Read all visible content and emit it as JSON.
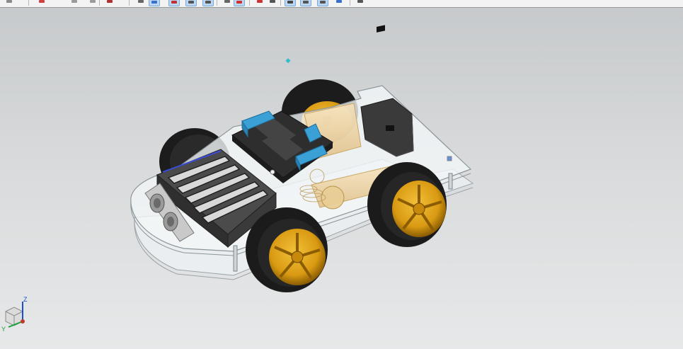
{
  "toolbar": {
    "buttons": [
      {
        "icon": "undo-icon"
      },
      {
        "icon": "new-file-icon"
      },
      {
        "icon": "back-arrow-icon"
      },
      {
        "icon": "forward-arrow-icon"
      },
      {
        "icon": "measure-icon"
      },
      {
        "icon": "sphere-icon"
      },
      {
        "icon": "view-cube-icon",
        "active": true
      },
      {
        "icon": "select-icon",
        "active": true
      },
      {
        "icon": "curve-icon",
        "active": true
      },
      {
        "icon": "pointer-icon",
        "active": true
      },
      {
        "icon": "snap-icon"
      },
      {
        "icon": "point-icon",
        "active": true
      },
      {
        "icon": "marker-icon"
      },
      {
        "icon": "arc-icon"
      },
      {
        "icon": "rotate-icon",
        "active": true
      },
      {
        "icon": "line-icon",
        "active": true
      },
      {
        "icon": "extend-icon",
        "active": true
      },
      {
        "icon": "arrow-left-icon"
      },
      {
        "icon": "orient-icon"
      }
    ]
  },
  "viewport": {
    "model": "robot-car-chassis",
    "background_top": "#c7cacc",
    "background_bottom": "#e7e8e9",
    "colors": {
      "tire": "#1b1b1b",
      "rim": "#d99a12",
      "rim_dark": "#9a6a06",
      "board": "#2b2b2b",
      "terminal": "#3aa0d6",
      "motor": "#f0d7a8",
      "acrylic": "#e9eef0",
      "holder": "#4b4b4b",
      "sensor": "#c9c9c9"
    }
  },
  "triad": {
    "z_label": "Z",
    "y_label": "Y",
    "z_color": "#1a4fd0",
    "y_color": "#17a33a",
    "x_color": "#c0392b"
  }
}
